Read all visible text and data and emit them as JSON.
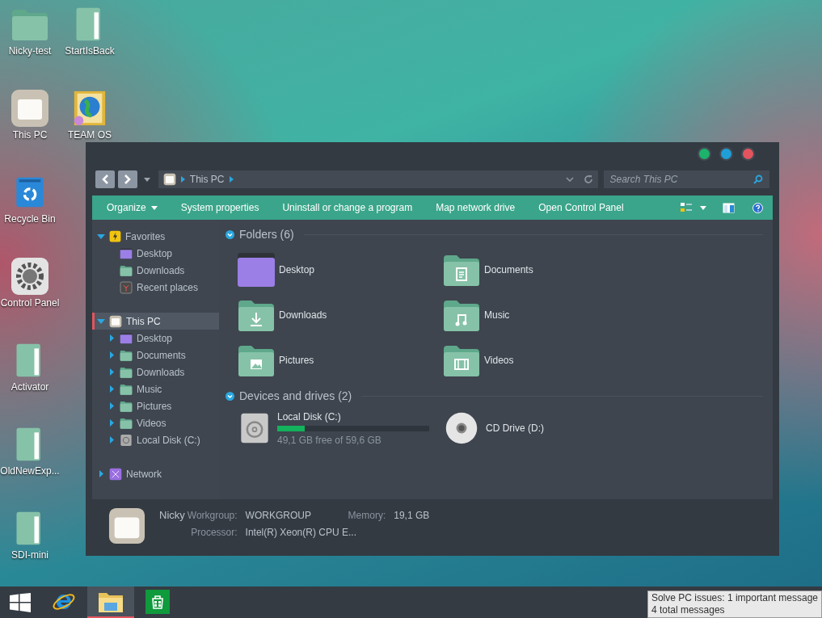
{
  "desktop_icons": [
    [
      {
        "label": "Nicky-test",
        "kind": "folder"
      },
      {
        "label": "StartIsBack",
        "kind": "binder"
      }
    ],
    [
      {
        "label": "This PC",
        "kind": "pc"
      },
      {
        "label": "TEAM OS",
        "kind": "globe"
      }
    ],
    [
      {
        "label": "Recycle Bin",
        "kind": "recycle"
      }
    ],
    [
      {
        "label": "Control Panel",
        "kind": "gear"
      }
    ],
    [
      {
        "label": "Activator",
        "kind": "binder"
      }
    ],
    [
      {
        "label": "OldNewExp...",
        "kind": "binder"
      }
    ],
    [
      {
        "label": "SDI-mini",
        "kind": "binder"
      }
    ]
  ],
  "window": {
    "address": {
      "path": "This PC"
    },
    "search": {
      "placeholder": "Search This PC"
    },
    "commands": [
      {
        "label": "Organize",
        "dropdown": true
      },
      {
        "label": "System properties",
        "dropdown": false
      },
      {
        "label": "Uninstall or change a program",
        "dropdown": false
      },
      {
        "label": "Map network drive",
        "dropdown": false
      },
      {
        "label": "Open Control Panel",
        "dropdown": false
      }
    ],
    "navigation": [
      {
        "label": "Favorites",
        "kind": "star",
        "expanded": true,
        "selected": false,
        "children": [
          {
            "label": "Desktop",
            "kind": "desktop",
            "selected": false
          },
          {
            "label": "Downloads",
            "kind": "folder",
            "selected": false
          },
          {
            "label": "Recent places",
            "kind": "recent",
            "selected": false
          }
        ]
      },
      {
        "label": "This PC",
        "kind": "pc",
        "expanded": true,
        "selected": true,
        "children": [
          {
            "label": "Desktop",
            "kind": "desktop",
            "expanded": false,
            "selected": false
          },
          {
            "label": "Documents",
            "kind": "folder",
            "expanded": false,
            "selected": false
          },
          {
            "label": "Downloads",
            "kind": "folder",
            "expanded": false,
            "selected": false
          },
          {
            "label": "Music",
            "kind": "folder",
            "expanded": false,
            "selected": false
          },
          {
            "label": "Pictures",
            "kind": "folder",
            "expanded": false,
            "selected": false
          },
          {
            "label": "Videos",
            "kind": "folder",
            "expanded": false,
            "selected": false
          },
          {
            "label": "Local Disk (C:)",
            "kind": "disk",
            "expanded": false,
            "selected": false
          }
        ]
      },
      {
        "label": "Network",
        "kind": "network",
        "expanded": false,
        "selected": false
      }
    ],
    "folders": {
      "heading": "Folders (6)",
      "items": [
        {
          "label": "Desktop",
          "kind": "desktop"
        },
        {
          "label": "Documents",
          "kind": "documents"
        },
        {
          "label": "Downloads",
          "kind": "downloads"
        },
        {
          "label": "Music",
          "kind": "music"
        },
        {
          "label": "Pictures",
          "kind": "pictures"
        },
        {
          "label": "Videos",
          "kind": "videos"
        }
      ]
    },
    "devices": {
      "heading": "Devices and drives (2)",
      "items": [
        {
          "label": "Local Disk (C:)",
          "kind": "disk",
          "level": 0.18,
          "free": "49,1 GB free of 59,6 GB"
        },
        {
          "label": "CD Drive (D:)",
          "kind": "cd"
        }
      ]
    },
    "details": {
      "name": "Nicky",
      "fields": [
        {
          "label": "Workgroup:",
          "value": "WORKGROUP"
        },
        {
          "label": "Memory:",
          "value": "19,1 GB"
        },
        {
          "label": "Processor:",
          "value": "Intel(R) Xeon(R) CPU E..."
        }
      ]
    }
  },
  "taskbar": {
    "apps": [
      {
        "kind": "ie",
        "selected": false
      },
      {
        "kind": "explorer",
        "selected": true
      },
      {
        "kind": "store",
        "selected": false
      }
    ]
  },
  "tooltip": {
    "lines": [
      "Solve PC issues: 1 important message",
      "4 total messages"
    ]
  }
}
